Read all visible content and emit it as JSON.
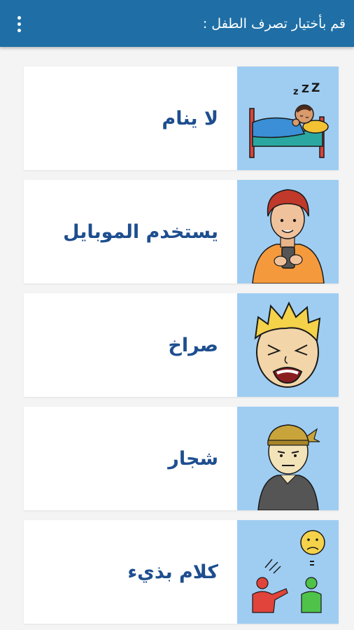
{
  "app_bar": {
    "title": "قم بأختيار تصرف الطفل :",
    "menu_icon": "more-vert-icon"
  },
  "colors": {
    "app_bar": "#1f6fa6",
    "label_text": "#1d4e8f",
    "image_bg": "#9fcdf2"
  },
  "behaviors": [
    {
      "label": "لا ينام",
      "icon": "sleeping-child-icon"
    },
    {
      "label": "يستخدم الموبايل",
      "icon": "child-phone-icon"
    },
    {
      "label": "صراخ",
      "icon": "screaming-child-icon"
    },
    {
      "label": "شجار",
      "icon": "fighting-child-icon"
    },
    {
      "label": "كلام بذيء",
      "icon": "rude-talk-icon"
    }
  ]
}
